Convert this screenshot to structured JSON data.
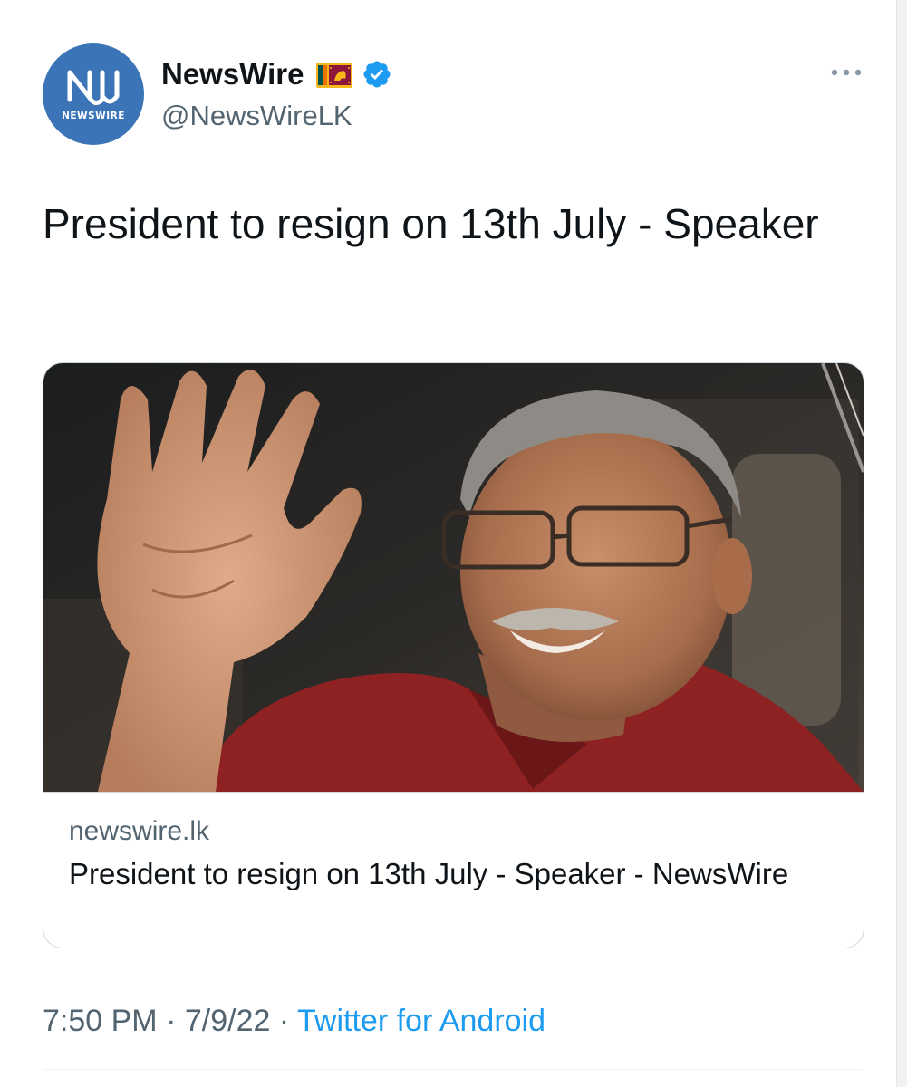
{
  "author": {
    "display_name": "NewsWire",
    "handle": "@NewsWireLK",
    "avatar_word": "NEWSWIRE",
    "flag_icon": "sri-lanka-flag-icon",
    "verified_icon": "verified-badge-icon",
    "verified_color": "#1d9bf0",
    "avatar_color": "#3c74b8"
  },
  "more_menu_icon": "more-options-icon",
  "tweet": {
    "text": "President to resign on 13th July - Speaker"
  },
  "card": {
    "image_description_icon": "news-photo",
    "domain": "newswire.lk",
    "title": "President to resign on 13th July - Speaker - NewsWire"
  },
  "meta": {
    "time": "7:50 PM",
    "separator": "·",
    "date": "7/9/22",
    "source": "Twitter for Android",
    "source_color": "#1d9bf0"
  }
}
